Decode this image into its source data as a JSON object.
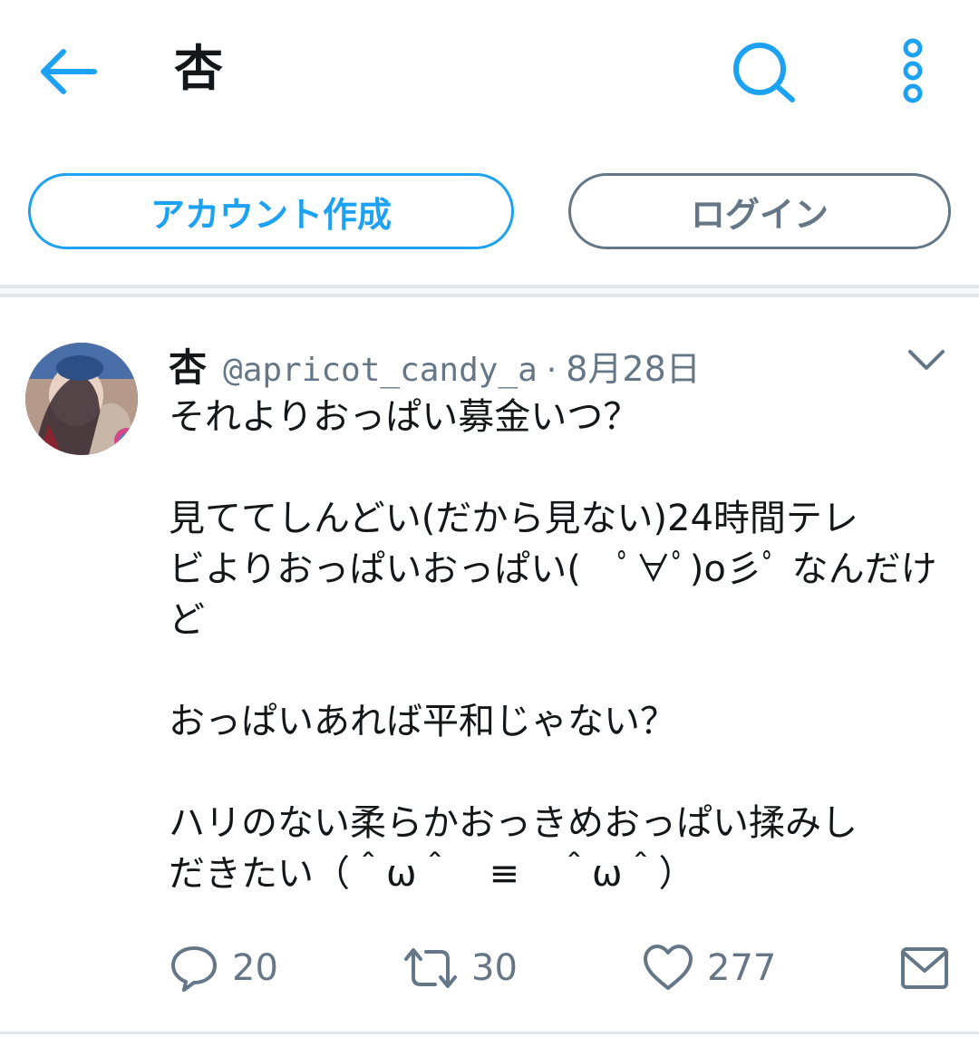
{
  "header": {
    "title": "杏",
    "back_icon": "arrow-left-icon",
    "search_icon": "search-icon",
    "more_icon": "vertical-dots-icon"
  },
  "auth": {
    "signup_label": "アカウント作成",
    "login_label": "ログイン"
  },
  "tweet": {
    "author_name": "杏",
    "author_handle": "@apricot_candy_a",
    "separator": "·",
    "date": "8月28日",
    "lines": [
      "それよりおっぱい募金いつ？",
      "",
      "見ててしんどい(だから見ない)24時間テレ",
      "ビよりおっぱいおっぱい(　ﾟ∀ﾟ)o彡ﾟ なんだけど",
      "",
      "",
      "おっぱいあれば平和じゃない？",
      "",
      "ハリのない柔らかおっきめおっぱい揉みし",
      "だきたい（＾ω＾　≡　＾ω＾）"
    ],
    "actions": {
      "reply_count": "20",
      "retweet_count": "30",
      "like_count": "277"
    }
  },
  "colors": {
    "accent": "#1da1f2",
    "text": "#14171a",
    "secondary": "#657786",
    "divider": "#e1e6ea"
  }
}
